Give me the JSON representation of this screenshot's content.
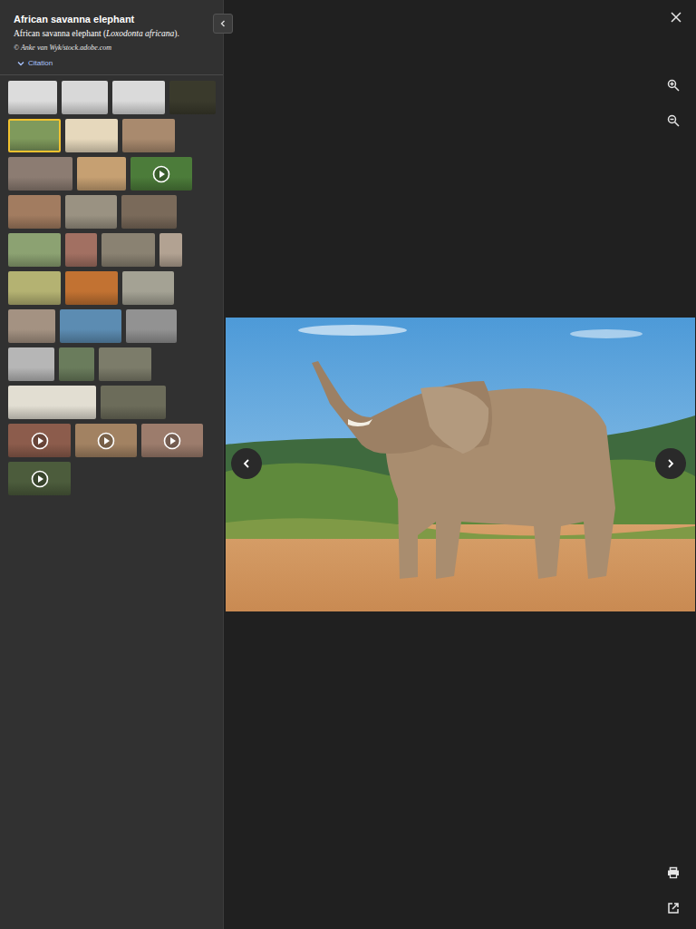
{
  "viewer": {
    "title": "African savanna elephant",
    "caption": {
      "text": "African savanna elephant (",
      "species": "Loxodonta africana",
      "end": ")."
    },
    "credit": "© Anke van Wyk/stock.adobe.com",
    "citation": "Citation",
    "citation_expanded": false
  },
  "thumbnail_rows": [
    [
      {
        "kind": "image",
        "selected": false,
        "color": "#dcdcdc"
      },
      {
        "kind": "image",
        "selected": false,
        "color": "#d8d8d8"
      },
      {
        "kind": "image",
        "selected": false,
        "color": "#dadada"
      },
      {
        "kind": "image",
        "selected": false,
        "color": "#3a3a2c"
      }
    ],
    [
      {
        "kind": "image",
        "selected": true,
        "color": "#7f9a5c"
      },
      {
        "kind": "image",
        "selected": false,
        "color": "#e6d8bc"
      },
      {
        "kind": "image",
        "selected": false,
        "color": "#a98a6e"
      }
    ],
    [
      {
        "kind": "image",
        "selected": false,
        "color": "#8c7c72"
      },
      {
        "kind": "image",
        "selected": false,
        "color": "#c6a072"
      },
      {
        "kind": "video",
        "selected": false,
        "color": "#4c7c3a"
      }
    ],
    [
      {
        "kind": "image",
        "selected": false,
        "color": "#a27c60"
      },
      {
        "kind": "image",
        "selected": false,
        "color": "#9a9282"
      },
      {
        "kind": "image",
        "selected": false,
        "color": "#7a6a5a"
      }
    ],
    [
      {
        "kind": "image",
        "selected": false,
        "color": "#8ca272"
      },
      {
        "kind": "image",
        "selected": false,
        "color": "#a27062"
      },
      {
        "kind": "image",
        "selected": false,
        "color": "#8a8272"
      },
      {
        "kind": "image",
        "selected": false,
        "color": "#b2a292"
      }
    ],
    [
      {
        "kind": "image",
        "selected": false,
        "color": "#b4b272"
      },
      {
        "kind": "image",
        "selected": false,
        "color": "#c27232"
      },
      {
        "kind": "image",
        "selected": false,
        "color": "#a4a294"
      }
    ],
    [
      {
        "kind": "image",
        "selected": false,
        "color": "#a49282"
      },
      {
        "kind": "image",
        "selected": false,
        "color": "#5c8cb2"
      },
      {
        "kind": "image",
        "selected": false,
        "color": "#929292"
      }
    ],
    [
      {
        "kind": "image",
        "selected": false,
        "color": "#b6b6b6"
      },
      {
        "kind": "image",
        "selected": false,
        "color": "#6a7c5c"
      },
      {
        "kind": "image",
        "selected": false,
        "color": "#7c7c6a"
      }
    ],
    [
      {
        "kind": "image",
        "selected": false,
        "color": "#e2ded2"
      },
      {
        "kind": "image",
        "selected": false,
        "color": "#6c6c5a"
      }
    ],
    [
      {
        "kind": "video",
        "selected": false,
        "color": "#8c5c4c"
      },
      {
        "kind": "video",
        "selected": false,
        "color": "#a28262"
      },
      {
        "kind": "video",
        "selected": false,
        "color": "#9c7c6c"
      }
    ],
    [
      {
        "kind": "video",
        "selected": false,
        "color": "#4c5c3c"
      }
    ]
  ]
}
